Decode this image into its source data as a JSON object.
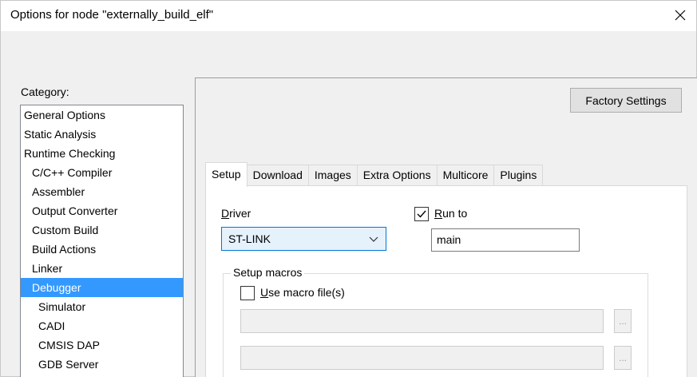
{
  "window": {
    "title": "Options for node \"externally_build_elf\""
  },
  "category": {
    "label": "Category:",
    "items": [
      {
        "label": "General Options",
        "level": 0,
        "selected": false
      },
      {
        "label": "Static Analysis",
        "level": 0,
        "selected": false
      },
      {
        "label": "Runtime Checking",
        "level": 0,
        "selected": false
      },
      {
        "label": "C/C++ Compiler",
        "level": 1,
        "selected": false
      },
      {
        "label": "Assembler",
        "level": 1,
        "selected": false
      },
      {
        "label": "Output Converter",
        "level": 1,
        "selected": false
      },
      {
        "label": "Custom Build",
        "level": 1,
        "selected": false
      },
      {
        "label": "Build Actions",
        "level": 1,
        "selected": false
      },
      {
        "label": "Linker",
        "level": 1,
        "selected": false
      },
      {
        "label": "Debugger",
        "level": 1,
        "selected": true
      },
      {
        "label": "Simulator",
        "level": 2,
        "selected": false
      },
      {
        "label": "CADI",
        "level": 2,
        "selected": false
      },
      {
        "label": "CMSIS DAP",
        "level": 2,
        "selected": false
      },
      {
        "label": "GDB Server",
        "level": 2,
        "selected": false
      }
    ]
  },
  "panel": {
    "factory_settings_label": "Factory Settings",
    "tabs": [
      {
        "label": "Setup",
        "active": true
      },
      {
        "label": "Download",
        "active": false
      },
      {
        "label": "Images",
        "active": false
      },
      {
        "label": "Extra Options",
        "active": false
      },
      {
        "label": "Multicore",
        "active": false
      },
      {
        "label": "Plugins",
        "active": false
      }
    ],
    "setup": {
      "driver_label_first": "D",
      "driver_label_rest": "river",
      "driver_value": "ST-LINK",
      "run_to_checked": true,
      "run_to_label_first": "R",
      "run_to_label_rest": "un to",
      "run_to_value": "main",
      "macros_group_title": "Setup macros",
      "use_macro_checked": false,
      "use_macro_label_first": "U",
      "use_macro_label_rest": "se macro file(s)",
      "macro_file_1": "",
      "macro_file_2": "",
      "browse_label": "..."
    }
  },
  "colors": {
    "selection": "#3399ff",
    "dialog_bg": "#f0f0f0",
    "focus_border": "#0078d7"
  }
}
